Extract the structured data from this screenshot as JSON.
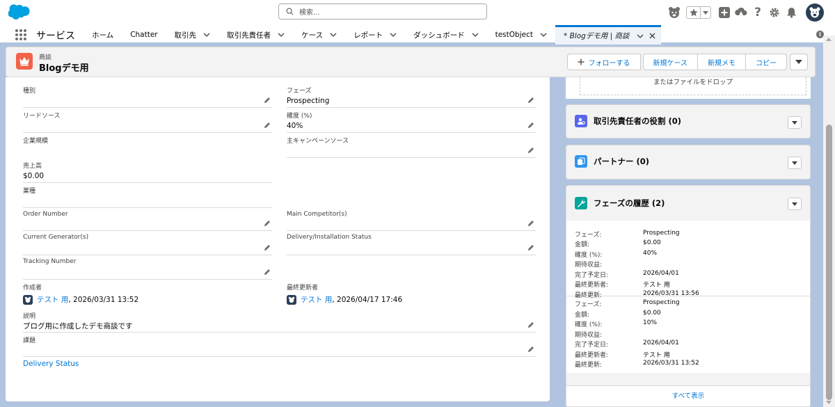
{
  "header": {
    "search_placeholder": "検索...",
    "icons": [
      "bear-mascot-icon",
      "star-favorite-icon",
      "favorites-dropdown-icon",
      "add-icon",
      "trailhead-cloud-icon",
      "help-icon",
      "setup-gear-icon",
      "notifications-bell-icon",
      "user-avatar-icon"
    ]
  },
  "nav": {
    "app_name": "サービス",
    "items": [
      {
        "label": "ホーム"
      },
      {
        "label": "Chatter"
      },
      {
        "label": "取引先"
      },
      {
        "label": "取引先責任者"
      },
      {
        "label": "ケース"
      },
      {
        "label": "レポート"
      },
      {
        "label": "ダッシュボード"
      },
      {
        "label": "testObject"
      }
    ],
    "active_tab": "* Blogデモ用 | 商談"
  },
  "record": {
    "type": "商談",
    "title": "Blogデモ用",
    "actions": {
      "follow": "フォローする",
      "new_case": "新規ケース",
      "new_note": "新規メモ",
      "copy": "コピー"
    }
  },
  "fields": {
    "type": {
      "label": "種別",
      "value": ""
    },
    "phase": {
      "label": "フェーズ",
      "value": "Prospecting"
    },
    "lead_source": {
      "label": "リードソース",
      "value": ""
    },
    "probability": {
      "label": "確度 (%)",
      "value": "40%"
    },
    "company_size": {
      "label": "企業規模",
      "value": ""
    },
    "primary_campaign": {
      "label": "主キャンペーンソース",
      "value": ""
    },
    "revenue": {
      "label": "売上高",
      "value": "$0.00"
    },
    "industry": {
      "label": "業種",
      "value": ""
    },
    "order_number": {
      "label": "Order Number",
      "value": ""
    },
    "main_competitors": {
      "label": "Main Competitor(s)",
      "value": ""
    },
    "current_generators": {
      "label": "Current Generator(s)",
      "value": ""
    },
    "delivery_status_field": {
      "label": "Delivery/Installation Status",
      "value": ""
    },
    "tracking_number": {
      "label": "Tracking Number",
      "value": ""
    },
    "created_by": {
      "label": "作成者",
      "user": "テスト 用",
      "date": ", 2026/03/31 13:52"
    },
    "last_modified_by": {
      "label": "最終更新者",
      "user": "テスト 用",
      "date": ", 2026/04/17 17:46"
    },
    "description": {
      "label": "説明",
      "value": "ブログ用に作成したデモ商談です"
    },
    "issue": {
      "label": "課題",
      "value": ""
    },
    "delivery_status_section": "Delivery Status"
  },
  "right": {
    "drop_text": "またはファイルをドロップ",
    "contact_roles": "取引先責任者の役割 (0)",
    "partners": "パートナー (0)",
    "phase_history": "フェーズの履歴 (2)",
    "history_labels": {
      "phase": "フェーズ:",
      "amount": "金額:",
      "probability": "確度 (%):",
      "expected_revenue": "期待収益:",
      "close_date": "完了予定日:",
      "modified_by": "最終更新者:",
      "modified": "最終更新:"
    },
    "history": [
      {
        "phase": "Prospecting",
        "amount": "$0.00",
        "probability": "40%",
        "expected_revenue": "",
        "close_date": "2026/04/01",
        "modified_by": "テスト 用",
        "modified": "2026/03/31 13:56"
      },
      {
        "phase": "Prospecting",
        "amount": "$0.00",
        "probability": "10%",
        "expected_revenue": "",
        "close_date": "2026/04/01",
        "modified_by": "テスト 用",
        "modified": "2026/03/31 13:52"
      }
    ],
    "view_all": "すべて表示"
  },
  "colors": {
    "brand": "#0176d3",
    "opportunity_icon": "#f2634a",
    "contact_roles_icon": "#5867e8",
    "partners_icon": "#3296ed",
    "phase_history_icon": "#06a59a"
  }
}
